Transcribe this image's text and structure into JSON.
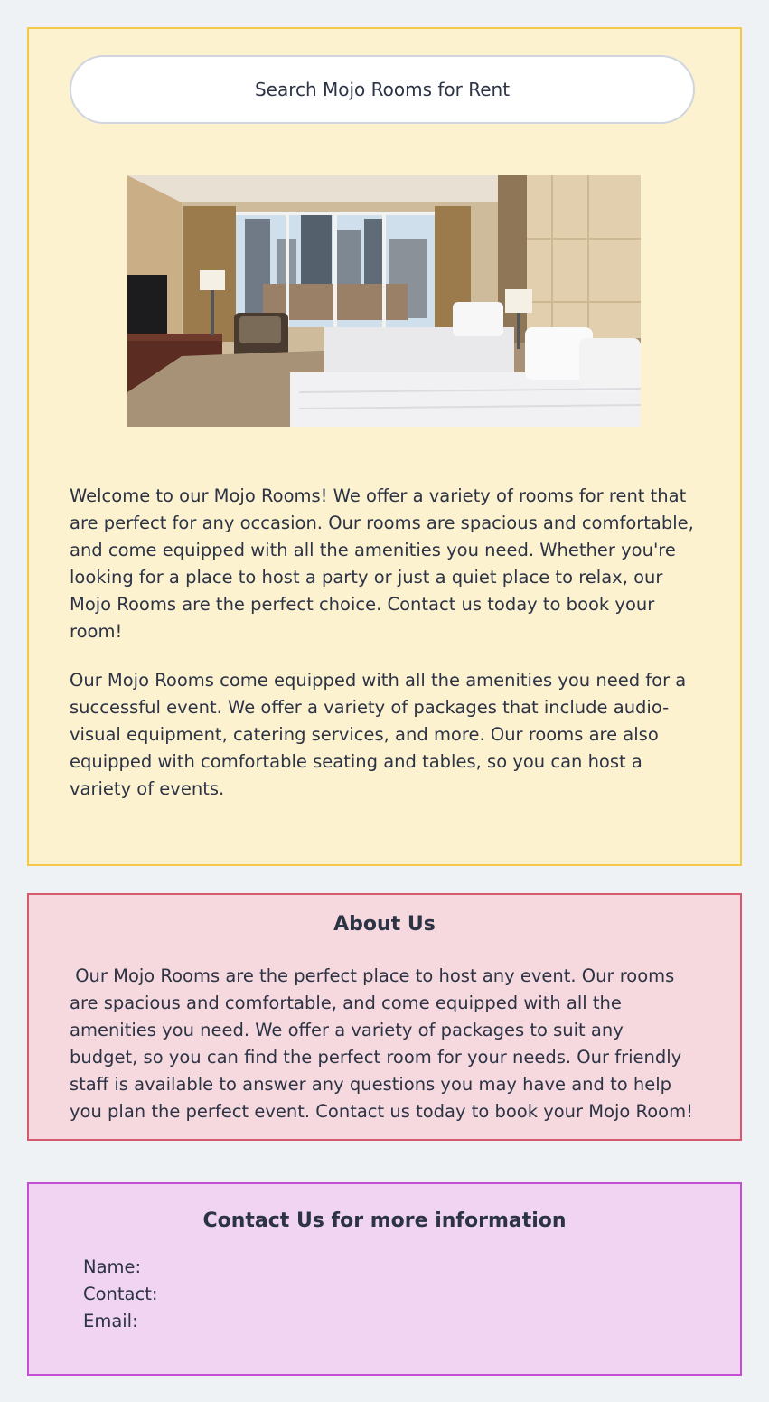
{
  "hero": {
    "search_label": "Search Mojo Rooms for Rent",
    "photo_alt": "Hotel room with two beds and city view",
    "paragraph_1": "Welcome to our Mojo Rooms! We offer a variety of rooms for rent that are perfect for any occasion. Our rooms are spacious and comfortable, and come equipped with all the amenities you need. Whether you're looking for a place to host a party or just a quiet place to relax, our Mojo Rooms are the perfect choice. Contact us today to book your room!",
    "paragraph_2": "Our Mojo Rooms come equipped with all the amenities you need for a successful event. We offer a variety of packages that include audio-visual equipment, catering services, and more. Our rooms are also equipped with comfortable seating and tables, so you can host a variety of events."
  },
  "about": {
    "title": "About Us",
    "body": " Our Mojo Rooms are the perfect place to host any event. Our rooms are spacious and comfortable, and come equipped with all the amenities you need. We offer a variety of packages to suit any budget, so you can find the perfect room for your needs. Our friendly staff is available to answer any questions you may have and to help you plan the perfect event. Contact us today to book your Mojo Room!"
  },
  "contact": {
    "title": "Contact Us for more information",
    "name_label": "Name:",
    "contact_label": "Contact:",
    "email_label": "Email:"
  },
  "colors": {
    "page_bg": "#eef2f5",
    "hero_bg": "#fdf2d0",
    "hero_border": "#f4c94a",
    "about_bg": "#f6d9de",
    "about_border": "#d65a6e",
    "contact_bg": "#f0d4f2",
    "contact_border": "#c44fd4",
    "text": "#2b3345"
  }
}
